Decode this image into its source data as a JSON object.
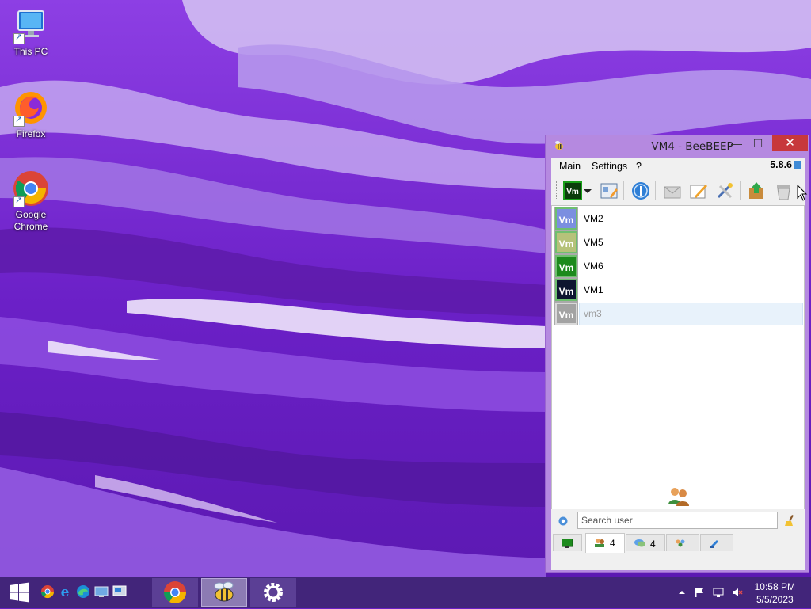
{
  "desktop": {
    "icons": [
      {
        "label": "This PC",
        "icon": "computer-icon"
      },
      {
        "label": "Firefox",
        "icon": "firefox-icon"
      },
      {
        "label": "Google Chrome",
        "icon": "chrome-icon"
      }
    ]
  },
  "window": {
    "title": "VM4 - BeeBEEP",
    "controls": {
      "minimize": "—",
      "maximize": "☐",
      "close": "✕"
    },
    "menu": [
      "Main",
      "Settings",
      "?"
    ],
    "version": "5.8.6",
    "toolbar_icons": [
      "status-vm-icon",
      "dropdown-arrow-icon",
      "profile-edit-icon",
      "network-icon",
      "envelope-icon",
      "note-edit-icon",
      "tools-icon",
      "upload-icon",
      "trash-icon"
    ],
    "users": [
      {
        "initials": "Vm",
        "name": "VM2",
        "color": "#7b8fe0",
        "online": true
      },
      {
        "initials": "Vm",
        "name": "VM5",
        "color": "#b6c27a",
        "online": true
      },
      {
        "initials": "Vm",
        "name": "VM6",
        "color": "#1d8a1d",
        "online": true
      },
      {
        "initials": "Vm",
        "name": "VM1",
        "color": "#0d1530",
        "online": true
      },
      {
        "initials": "Vm",
        "name": "vm3",
        "color": "#a3a3a3",
        "online": false
      }
    ],
    "search": {
      "placeholder": "Search user",
      "value": ""
    },
    "tabs": [
      {
        "icon": "monitor-icon",
        "count": ""
      },
      {
        "icon": "users-icon",
        "count": "4"
      },
      {
        "icon": "chat-icon",
        "count": "4"
      },
      {
        "icon": "group-icon",
        "count": ""
      },
      {
        "icon": "share-icon",
        "count": ""
      }
    ]
  },
  "taskbar": {
    "quick_launch": [
      "chrome-icon",
      "edge-legacy-icon",
      "edge-icon",
      "remote-desktop-icon",
      "network-monitor-icon"
    ],
    "tasks": [
      "chrome-icon",
      "beebeep-icon",
      "settings-icon"
    ],
    "clock": {
      "time": "10:58 PM",
      "date": "5/5/2023"
    }
  },
  "colors": {
    "accent": "#b589e0",
    "taskbar": "#42257a",
    "close": "#c7383c"
  }
}
